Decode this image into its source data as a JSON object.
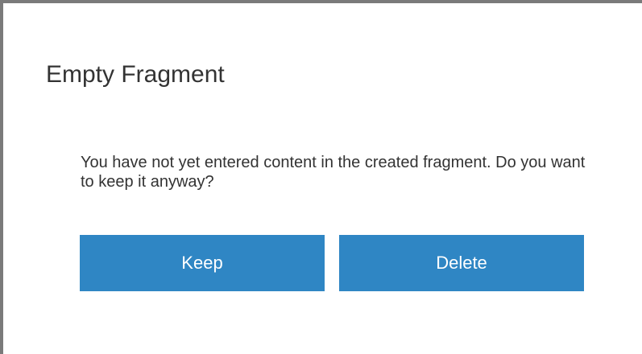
{
  "dialog": {
    "title": "Empty Fragment",
    "message": "You have not yet entered content in the created fragment. Do you want to keep it anyway?",
    "keep_label": "Keep",
    "delete_label": "Delete"
  },
  "colors": {
    "button_bg": "#2f86c4",
    "button_text": "#ffffff",
    "text": "#333333",
    "frame_border": "#7a7a7a"
  }
}
